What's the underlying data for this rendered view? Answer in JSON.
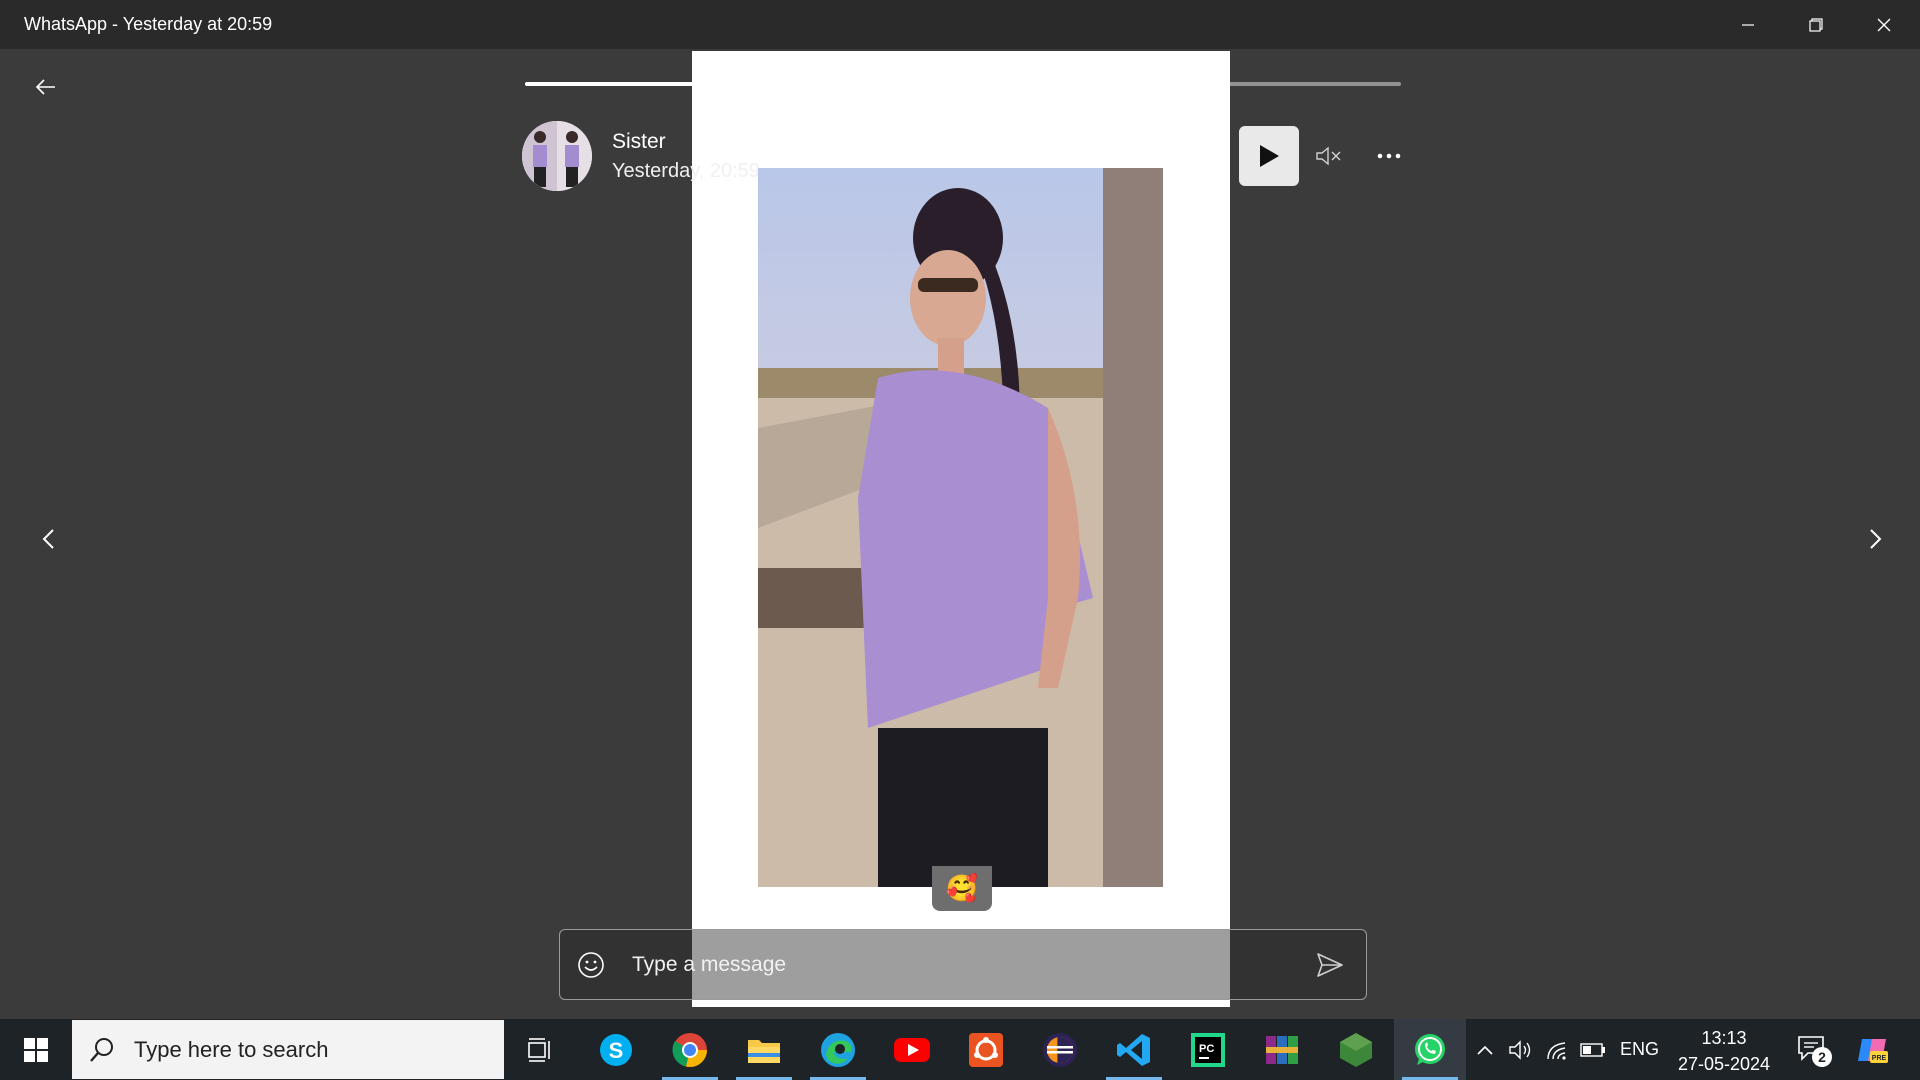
{
  "window": {
    "title": "WhatsApp - Yesterday at 20:59"
  },
  "status": {
    "poster_name": "Sister",
    "poster_time": "Yesterday, 20:59",
    "segments": [
      {
        "progress": 0.58
      },
      {
        "progress": 0
      },
      {
        "progress": 0
      }
    ],
    "reaction_emoji": "🥰"
  },
  "composer": {
    "placeholder": "Type a message"
  },
  "taskbar": {
    "search_placeholder": "Type here to search",
    "language": "ENG",
    "time": "13:13",
    "date": "27-05-2024",
    "notification_count": "2",
    "apps": [
      {
        "name": "task-view",
        "color": "#ffffff"
      },
      {
        "name": "skype",
        "color": "#00aff0"
      },
      {
        "name": "chrome",
        "color": "#db4437"
      },
      {
        "name": "file-explorer",
        "color": "#f7c948"
      },
      {
        "name": "edge",
        "color": "#1fa2e0"
      },
      {
        "name": "youtube",
        "color": "#ff0000"
      },
      {
        "name": "ubuntu",
        "color": "#e95420"
      },
      {
        "name": "eclipse",
        "color": "#2c2255"
      },
      {
        "name": "vscode",
        "color": "#23a9f2"
      },
      {
        "name": "pycharm",
        "color": "#21d789"
      },
      {
        "name": "winrar",
        "color": "#8b2a8b"
      },
      {
        "name": "nodejs",
        "color": "#3c873a"
      },
      {
        "name": "whatsapp",
        "color": "#25d366"
      }
    ]
  },
  "colors": {
    "viewer_bg": "#3b3b3b",
    "titlebar_bg": "#2a2a2a",
    "taskbar_bg": "#1e2328"
  }
}
